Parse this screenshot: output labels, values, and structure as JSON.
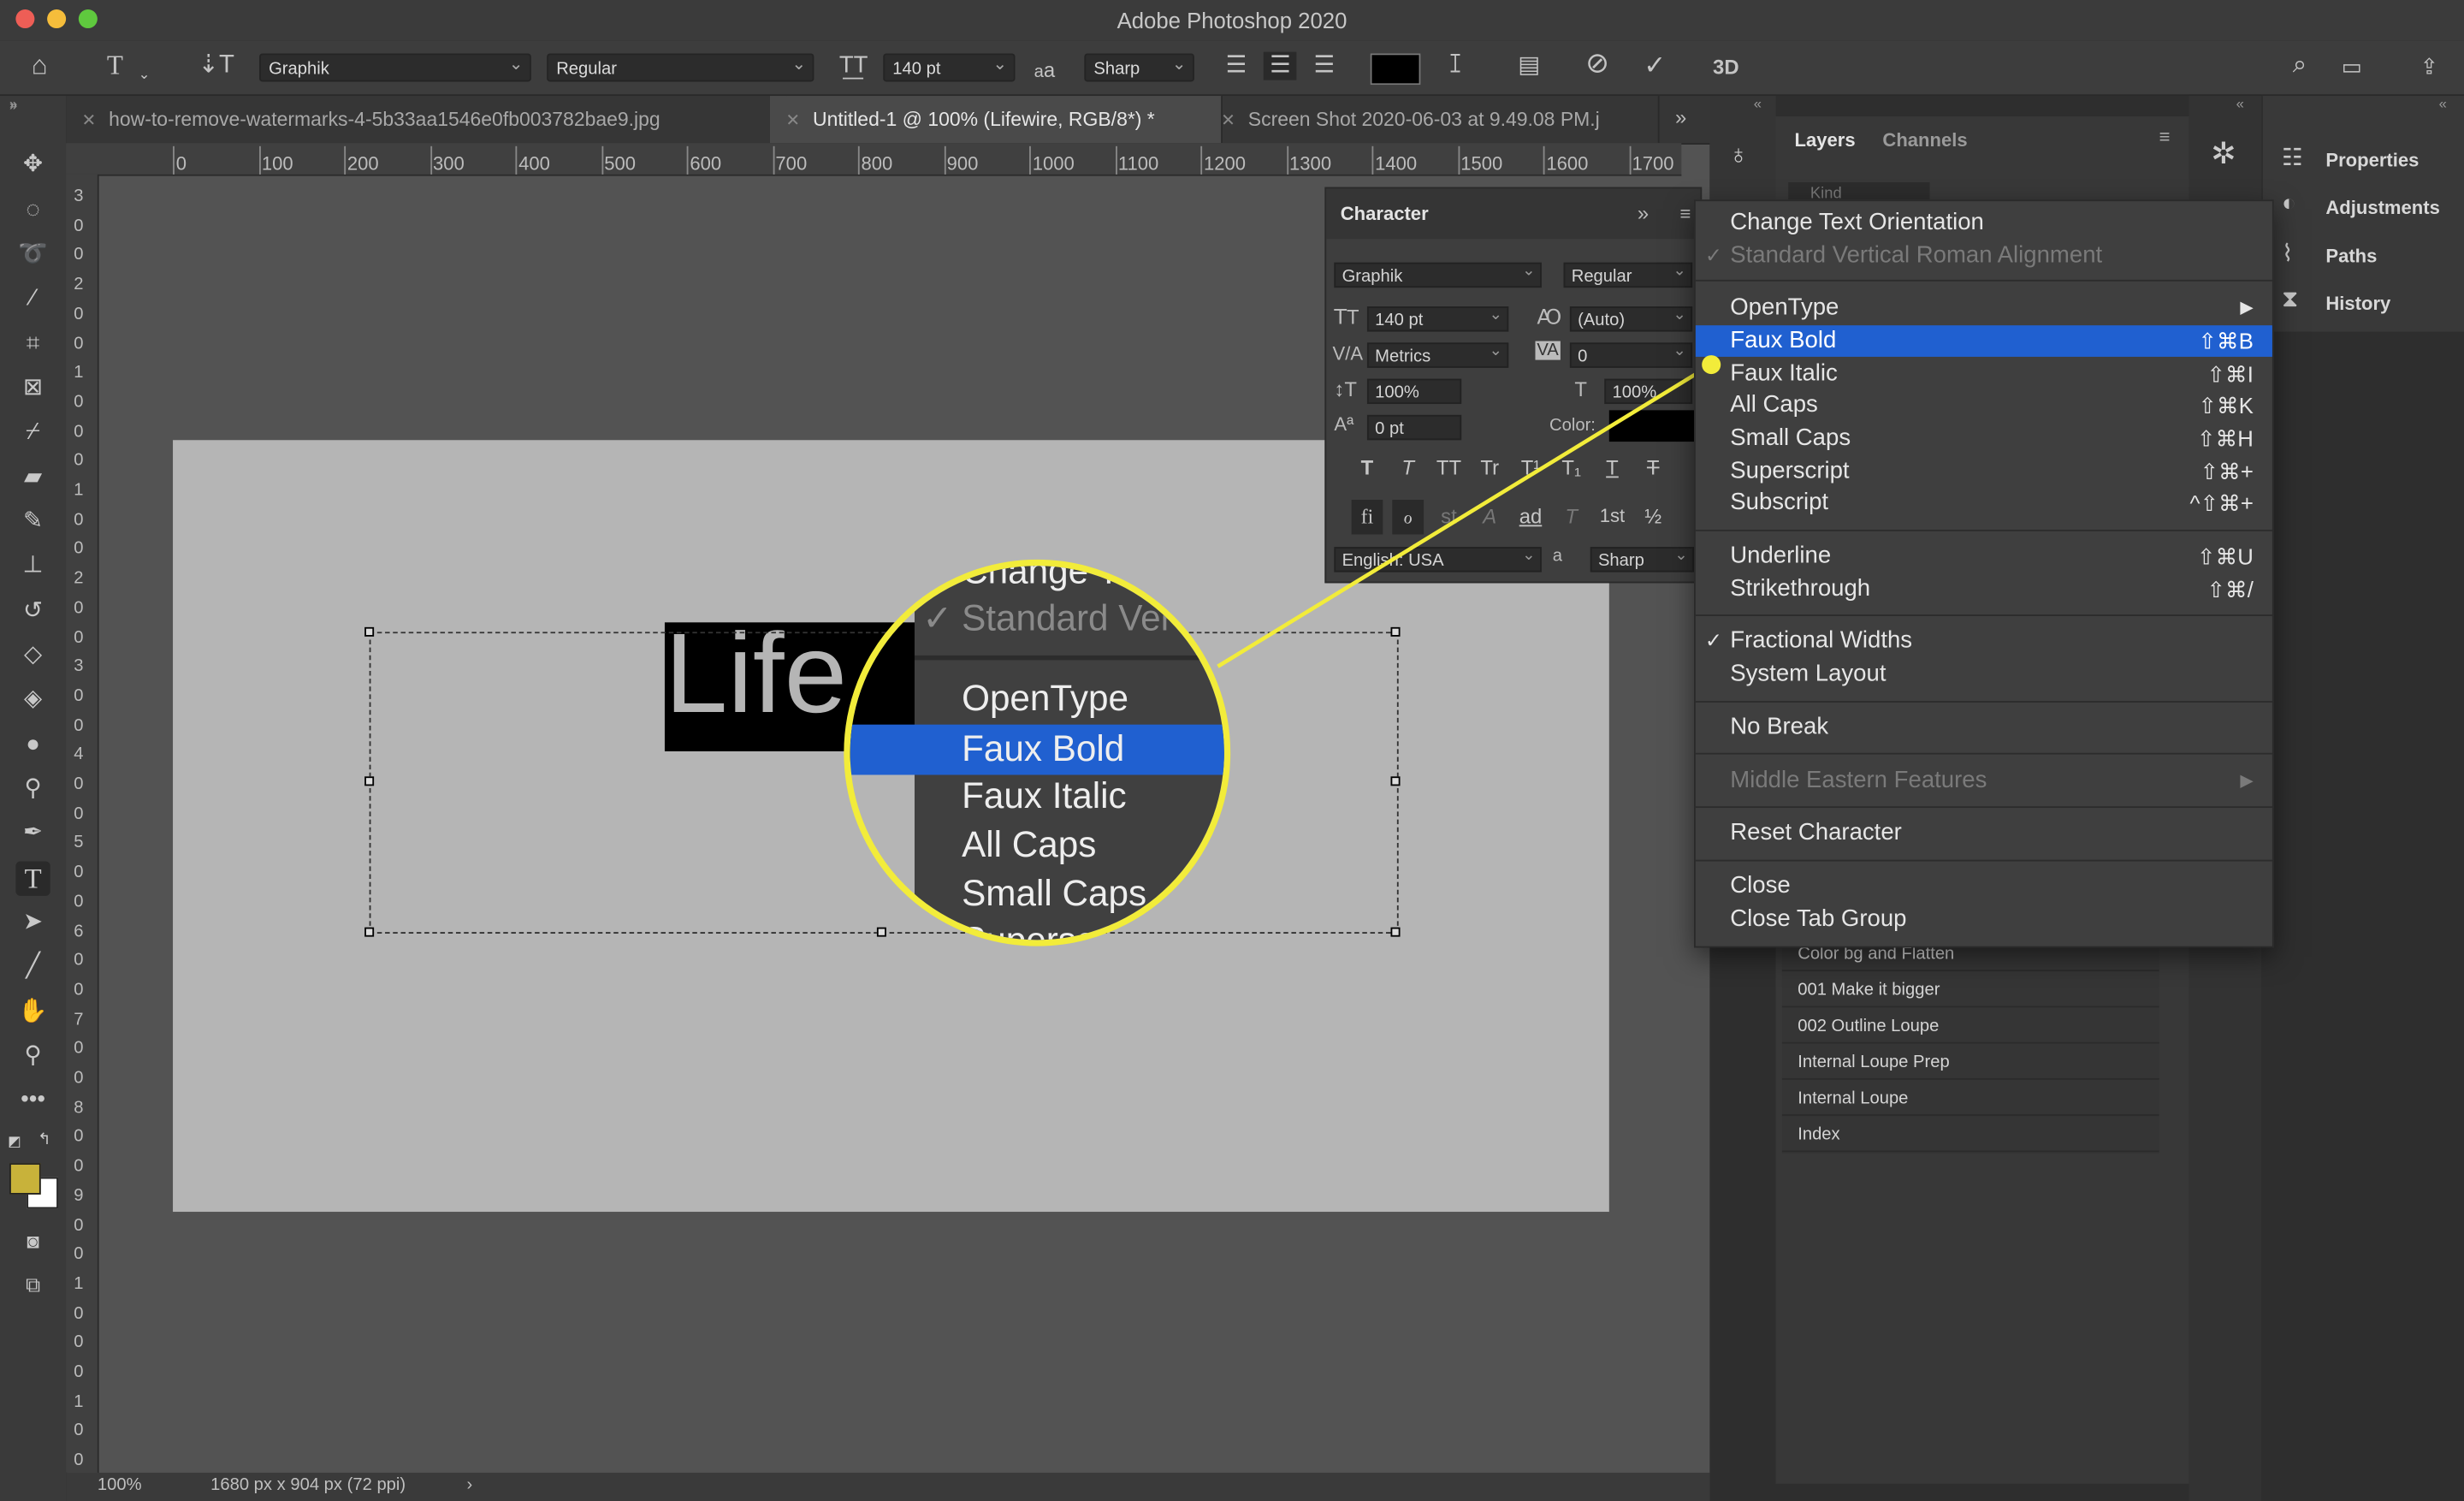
{
  "window": {
    "title": "Adobe Photoshop 2020"
  },
  "options_bar": {
    "font_family": "Graphik",
    "font_style": "Regular",
    "font_size": "140 pt",
    "aa_label": "a",
    "aa_label_big": "a",
    "anti_alias": "Sharp",
    "mode_3d": "3D",
    "text_color": "#000000"
  },
  "tabs": [
    {
      "label": "how-to-remove-watermarks-4-5b33aa1546e0fb003782bae9.jpg"
    },
    {
      "label": "Untitled-1 @ 100% (Lifewire, RGB/8*) *"
    },
    {
      "label": "Screen Shot 2020-06-03 at 9.49.08 PM.j"
    }
  ],
  "ruler": {
    "h": [
      "0",
      "100",
      "200",
      "300",
      "400",
      "500",
      "600",
      "700",
      "800",
      "900",
      "1000",
      "1100",
      "1200",
      "1300",
      "1400",
      "1500",
      "1600",
      "1700"
    ],
    "v": [
      "3",
      "0",
      "0",
      "2",
      "0",
      "0",
      "1",
      "0",
      "0",
      "0",
      "1",
      "0",
      "0",
      "2",
      "0",
      "0",
      "3",
      "0",
      "0",
      "4",
      "0",
      "0",
      "5",
      "0",
      "0",
      "6",
      "0",
      "0",
      "7",
      "0",
      "0",
      "8",
      "0",
      "0",
      "9",
      "0",
      "0",
      "1",
      "0",
      "0",
      "0",
      "1",
      "0",
      "0"
    ]
  },
  "document": {
    "text": "Life",
    "background": "#b5b5b5"
  },
  "status": {
    "zoom": "100%",
    "doc_info": "1680 px x 904 px (72 ppi)"
  },
  "character_panel": {
    "title": "Character",
    "font_family": "Graphik",
    "font_style": "Regular",
    "size": "140 pt",
    "leading": "(Auto)",
    "kerning": "Metrics",
    "tracking": "0",
    "vscale": "100%",
    "hscale": "100%",
    "baseline": "0 pt",
    "color_label": "Color:",
    "language": "English: USA",
    "anti_alias": "Sharp",
    "aa_icon": "a",
    "style_buttons": [
      "T",
      "T",
      "TT",
      "Tr",
      "T¹",
      "T₁",
      "T",
      "T"
    ],
    "ot_buttons": [
      "fi",
      "ℴ",
      "st",
      "A",
      "ad",
      "T",
      "1st",
      "½"
    ]
  },
  "layers_panel": {
    "tabs": [
      "Layers",
      "Channels"
    ],
    "search_placeholder": "Kind"
  },
  "actions": [
    "Color bg and Flatten",
    "001 Make it bigger",
    "002 Outline Loupe",
    "Internal Loupe Prep",
    "Internal Loupe",
    "Index"
  ],
  "dock": [
    "Properties",
    "Adjustments",
    "Paths",
    "History"
  ],
  "context_menu": {
    "change_orientation": "Change Text Orientation",
    "standard_vertical": "Standard Vertical Roman Alignment",
    "opentype": "OpenType",
    "faux_bold": {
      "label": "Faux Bold",
      "shortcut": "⇧⌘B"
    },
    "faux_italic": {
      "label": "Faux Italic",
      "shortcut": "⇧⌘I"
    },
    "all_caps": {
      "label": "All Caps",
      "shortcut": "⇧⌘K"
    },
    "small_caps": {
      "label": "Small Caps",
      "shortcut": "⇧⌘H"
    },
    "superscript": {
      "label": "Superscript",
      "shortcut": "⇧⌘+"
    },
    "subscript": {
      "label": "Subscript",
      "shortcut": "^⇧⌘+"
    },
    "underline": {
      "label": "Underline",
      "shortcut": "⇧⌘U"
    },
    "strikethrough": {
      "label": "Strikethrough",
      "shortcut": "⇧⌘/"
    },
    "fractional_widths": "Fractional Widths",
    "system_layout": "System Layout",
    "no_break": "No Break",
    "middle_eastern": "Middle Eastern Features",
    "reset_character": "Reset Character",
    "close": "Close",
    "close_tab_group": "Close Tab Group"
  },
  "loupe": {
    "items": [
      "Change T",
      "Standard Ver",
      "OpenType",
      "Faux Bold",
      "Faux Italic",
      "All Caps",
      "Small Caps",
      "Supersc"
    ]
  },
  "colors": {
    "highlight": "#2060d0",
    "callout": "#f2ec3a",
    "foreground": "#c8b23a",
    "background": "#ffffff"
  }
}
